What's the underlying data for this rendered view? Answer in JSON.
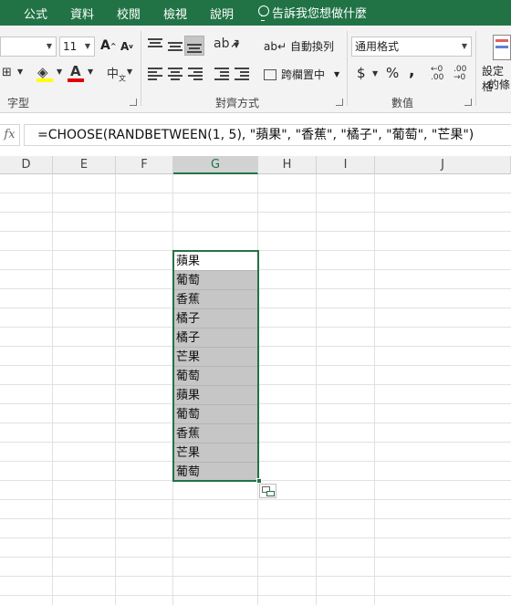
{
  "menu": {
    "items": [
      {
        "label": "公式"
      },
      {
        "label": "資料"
      },
      {
        "label": "校閱"
      },
      {
        "label": "檢視"
      },
      {
        "label": "說明"
      }
    ],
    "tell_me": "告訴我您想做什麼"
  },
  "ribbon": {
    "font": {
      "size": "11",
      "group_label": "字型"
    },
    "alignment": {
      "wrap_text": "自動換列",
      "merge_center": "跨欄置中",
      "group_label": "對齊方式"
    },
    "number": {
      "format": "通用格式",
      "currency": "$",
      "percent": "%",
      "comma": ",",
      "group_label": "數值"
    },
    "styles": {
      "conditional_line1": "設定格",
      "conditional_line2": "的條"
    }
  },
  "formula_bar": {
    "fx": "fx",
    "formula": "=CHOOSE(RANDBETWEEN(1, 5), \"蘋果\", \"香蕉\", \"橘子\", \"葡萄\", \"芒果\")"
  },
  "columns": [
    "D",
    "E",
    "F",
    "G",
    "H",
    "I",
    "J"
  ],
  "active_column": "G",
  "cells": [
    "蘋果",
    "葡萄",
    "香蕉",
    "橘子",
    "橘子",
    "芒果",
    "葡萄",
    "蘋果",
    "葡萄",
    "香蕉",
    "芒果",
    "葡萄"
  ],
  "colors": {
    "accent": "#217346",
    "selection_fill": "#c6c6c6"
  }
}
